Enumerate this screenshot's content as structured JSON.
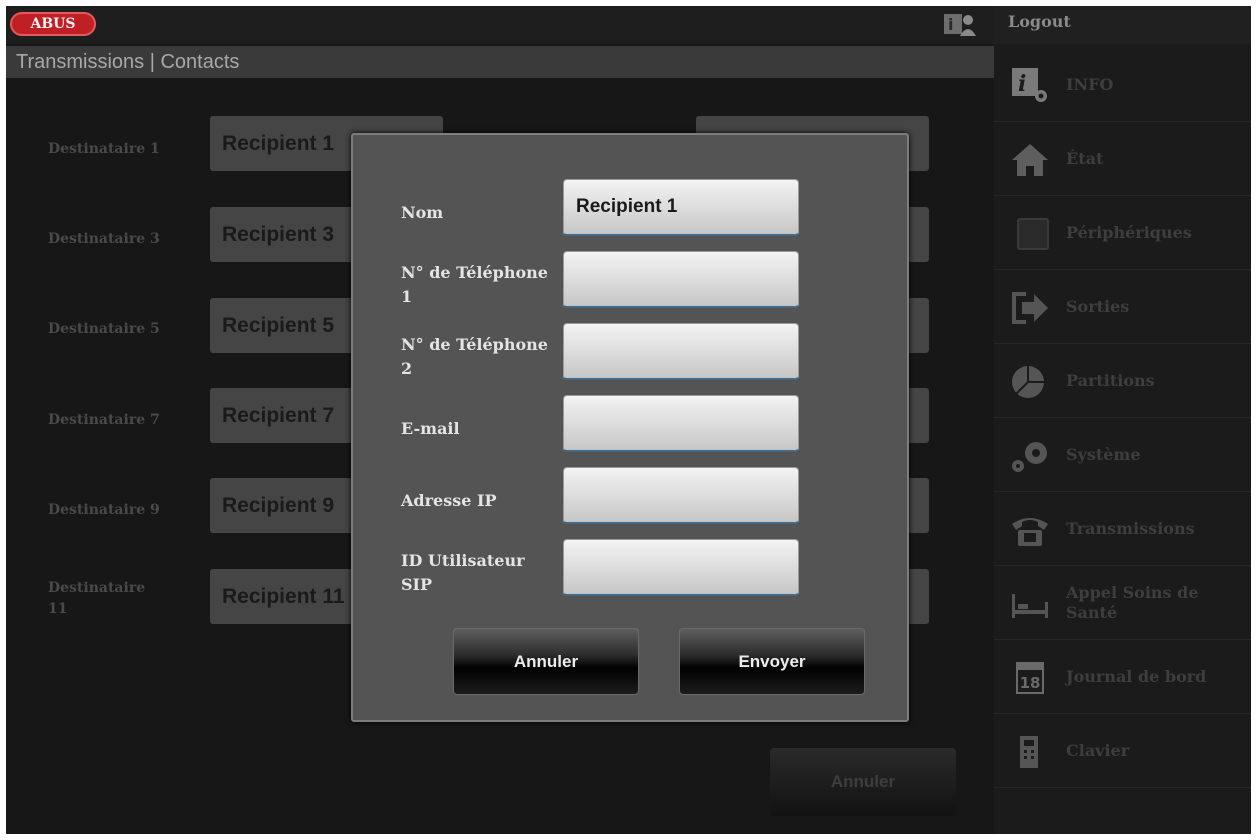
{
  "header": {
    "logo_text": "ABUS",
    "user_icon": "users-icon",
    "logout_label": "Logout"
  },
  "breadcrumb": "Transmissions | Contacts",
  "recipients": [
    {
      "label": "Destinataire 1",
      "value": "Recipient 1"
    },
    {
      "label": "Destinataire 3",
      "value": "Recipient 3"
    },
    {
      "label": "Destinataire 5",
      "value": "Recipient 5"
    },
    {
      "label": "Destinataire 7",
      "value": "Recipient 7"
    },
    {
      "label": "Destinataire 9",
      "value": "Recipient 9"
    },
    {
      "label": "Destinataire 11",
      "value": "Recipient 11"
    }
  ],
  "background_cancel_label": "Annuler",
  "sidebar": {
    "items": [
      {
        "label": "INFO",
        "icon": "info-settings-icon"
      },
      {
        "label": "État",
        "icon": "house-icon"
      },
      {
        "label": "Périphériques",
        "icon": "device-square-icon"
      },
      {
        "label": "Sorties",
        "icon": "output-arrow-icon"
      },
      {
        "label": "Partitions",
        "icon": "partition-pie-icon"
      },
      {
        "label": "Système",
        "icon": "gears-icon"
      },
      {
        "label": "Transmissions",
        "icon": "telephone-icon"
      },
      {
        "label": "Appel Soins de Santé",
        "icon": "bed-icon"
      },
      {
        "label": "Journal de bord",
        "icon": "calendar-icon"
      },
      {
        "label": "Clavier",
        "icon": "keypad-icon"
      }
    ]
  },
  "modal": {
    "fields": [
      {
        "label": "Nom",
        "value": ""
      },
      {
        "label": "N° de Téléphone 1",
        "value": ""
      },
      {
        "label": "N° de Téléphone 2",
        "value": ""
      },
      {
        "label": "E-mail",
        "value": ""
      },
      {
        "label": "Adresse IP",
        "value": ""
      },
      {
        "label": "ID Utilisateur SIP",
        "value": ""
      }
    ],
    "name_value": "Recipient 1",
    "cancel_label": "Annuler",
    "send_label": "Envoyer"
  },
  "calendar_day": "18",
  "colors": {
    "logo_red": "#c01f25",
    "modal_bg": "#545454",
    "field_bg": "#e0e0e0",
    "background": "#171717"
  }
}
